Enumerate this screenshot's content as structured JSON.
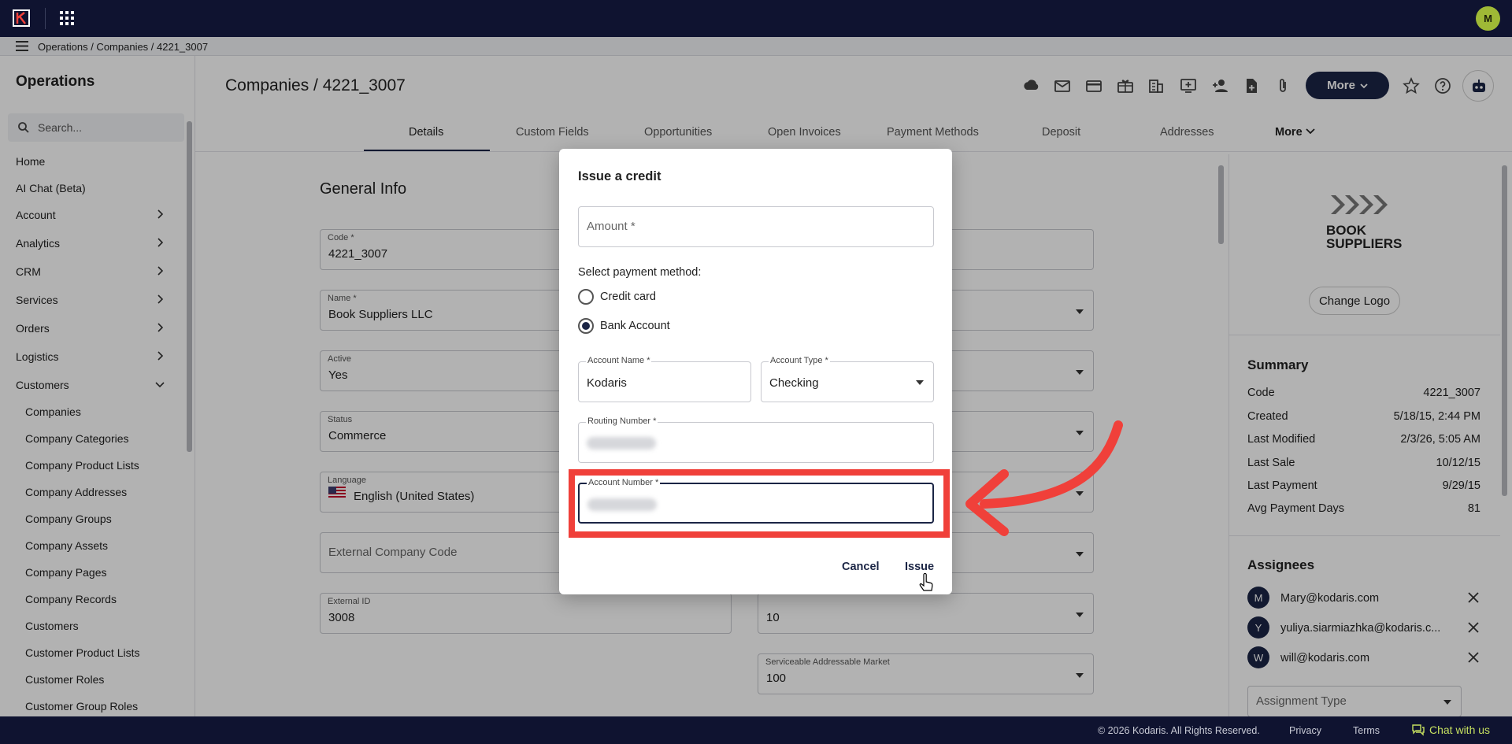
{
  "topbar": {
    "avatar_initial": "M"
  },
  "breadcrumb": "Operations / Companies / 4221_3007",
  "sidebar": {
    "title": "Operations",
    "search_placeholder": "Search...",
    "items": [
      {
        "label": "Home"
      },
      {
        "label": "AI Chat (Beta)"
      },
      {
        "label": "Account"
      },
      {
        "label": "Analytics"
      },
      {
        "label": "CRM"
      },
      {
        "label": "Services"
      },
      {
        "label": "Orders"
      },
      {
        "label": "Logistics"
      },
      {
        "label": "Customers"
      }
    ],
    "sub_items": [
      "Companies",
      "Company Categories",
      "Company Product Lists",
      "Company Addresses",
      "Company Groups",
      "Company Assets",
      "Company Pages",
      "Company Records",
      "Customers",
      "Customer Product Lists",
      "Customer Roles",
      "Customer Group Roles"
    ]
  },
  "page": {
    "title": "Companies / 4221_3007",
    "more_label": "More"
  },
  "tabs": [
    "Details",
    "Custom Fields",
    "Opportunities",
    "Open Invoices",
    "Payment Methods",
    "Deposit",
    "Addresses",
    "More"
  ],
  "general_info": {
    "title": "General Info",
    "code_label": "Code *",
    "code_value": "4221_3007",
    "name_label": "Name *",
    "name_value": "Book Suppliers LLC",
    "active_label": "Active",
    "active_value": "Yes",
    "status_label": "Status",
    "status_value": "Commerce",
    "language_label": "Language",
    "language_value": "English (United States)",
    "external_code_placeholder": "External Company Code",
    "external_id_label": "External ID",
    "external_id_value": "3008",
    "sam_value": "10",
    "serviceable_addressable_label": "Serviceable Addressable Market",
    "serviceable_addressable_value": "100"
  },
  "right_panel": {
    "logo_line1": "BOOK",
    "logo_line2": "SUPPLIERS",
    "change_logo": "Change Logo",
    "summary_title": "Summary",
    "summary": [
      {
        "k": "Code",
        "v": "4221_3007"
      },
      {
        "k": "Created",
        "v": "5/18/15, 2:44 PM"
      },
      {
        "k": "Last Modified",
        "v": "2/3/26, 5:05 AM"
      },
      {
        "k": "Last Sale",
        "v": "10/12/15"
      },
      {
        "k": "Last Payment",
        "v": "9/29/15"
      },
      {
        "k": "Avg Payment Days",
        "v": "81"
      }
    ],
    "assignees_title": "Assignees",
    "assignees": [
      {
        "initial": "M",
        "email": "Mary@kodaris.com"
      },
      {
        "initial": "Y",
        "email": "yuliya.siarmiazhka@kodaris.c..."
      },
      {
        "initial": "W",
        "email": "will@kodaris.com"
      }
    ],
    "assignment_type_placeholder": "Assignment Type"
  },
  "dialog": {
    "title": "Issue a credit",
    "amount_placeholder": "Amount *",
    "payment_method_label": "Select payment method:",
    "option_credit_card": "Credit card",
    "option_bank_account": "Bank Account",
    "account_name_label": "Account Name *",
    "account_name_value": "Kodaris",
    "account_type_label": "Account Type *",
    "account_type_value": "Checking",
    "routing_number_label": "Routing Number *",
    "account_number_label": "Account Number *",
    "cancel": "Cancel",
    "issue": "Issue"
  },
  "footer": {
    "copyright": "© 2026 Kodaris. All Rights Reserved.",
    "privacy": "Privacy",
    "terms": "Terms",
    "chat": "Chat with us"
  },
  "colors": {
    "navy": "#0f1330",
    "accent": "#1b2545",
    "highlight": "#f0403a",
    "chat": "#c6e060"
  }
}
